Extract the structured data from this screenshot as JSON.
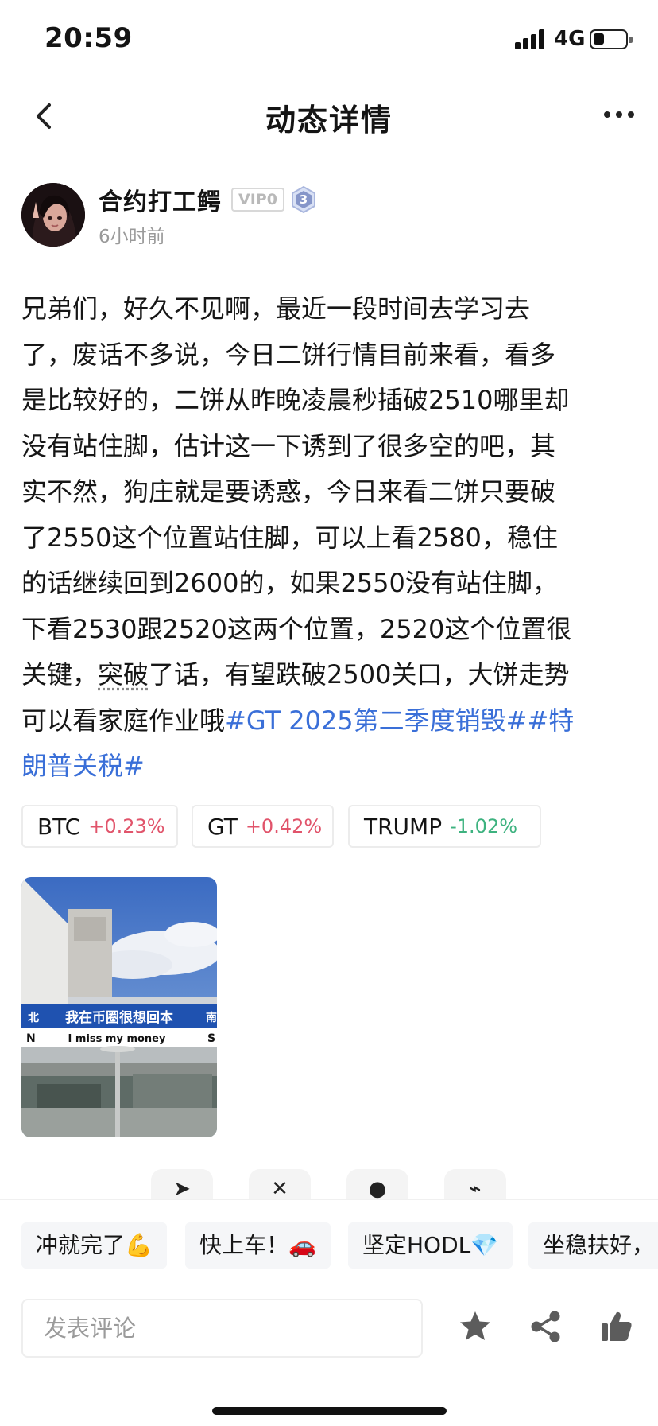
{
  "status_bar": {
    "time": "20:59",
    "network": "4G"
  },
  "nav": {
    "title": "动态详情"
  },
  "author": {
    "name": "合约打工鳄",
    "vip": "VIP0",
    "level": "3",
    "time_ago": "6小时前"
  },
  "post": {
    "lines": [
      "兄弟们，好久不见啊，最近一段时间去学习去",
      "了，废话不多说，今日二饼行情目前来看，看多",
      "是比较好的，二饼从昨晚凌晨秒插破2510哪里却",
      "没有站住脚，估计这一下诱到了很多空的吧，其",
      "实不然，狗庄就是要诱惑，今日来看二饼只要破",
      "了2550这个位置站住脚，可以上看2580，稳住",
      "的话继续回到2600的，如果2550没有站住脚，",
      "下看2530跟2520这两个位置，2520这个位置很"
    ],
    "line9_a": "关键，",
    "line9_dotted": "突破",
    "line9_b": "了话，有望跌破2500关口，大饼走势",
    "line10_text": "可以看家庭作业哦",
    "topic_1": "#GT 2025第二季度销毁#",
    "topic_2_start": "#特",
    "topic_2_end": "朗普关税#"
  },
  "coins": [
    {
      "symbol": "BTC",
      "change": "+0.23%",
      "direction": "up"
    },
    {
      "symbol": "GT",
      "change": "+0.42%",
      "direction": "up"
    },
    {
      "symbol": "TRUMP",
      "change": "-1.02%",
      "direction": "down"
    }
  ],
  "image": {
    "sign_left": "北",
    "sign_text": "我在币圈很想回本",
    "sign_right": "南",
    "sub_left": "N",
    "sub_text": "I miss my money",
    "sub_right": "S"
  },
  "quick_replies": [
    "冲就完了💪",
    "快上车！🚗",
    "坚定HODL💎",
    "坐稳扶好，"
  ],
  "comment": {
    "placeholder": "发表评论"
  },
  "colors": {
    "up": "#e1546b",
    "down": "#3db27f",
    "topic": "#3a6fd8"
  }
}
